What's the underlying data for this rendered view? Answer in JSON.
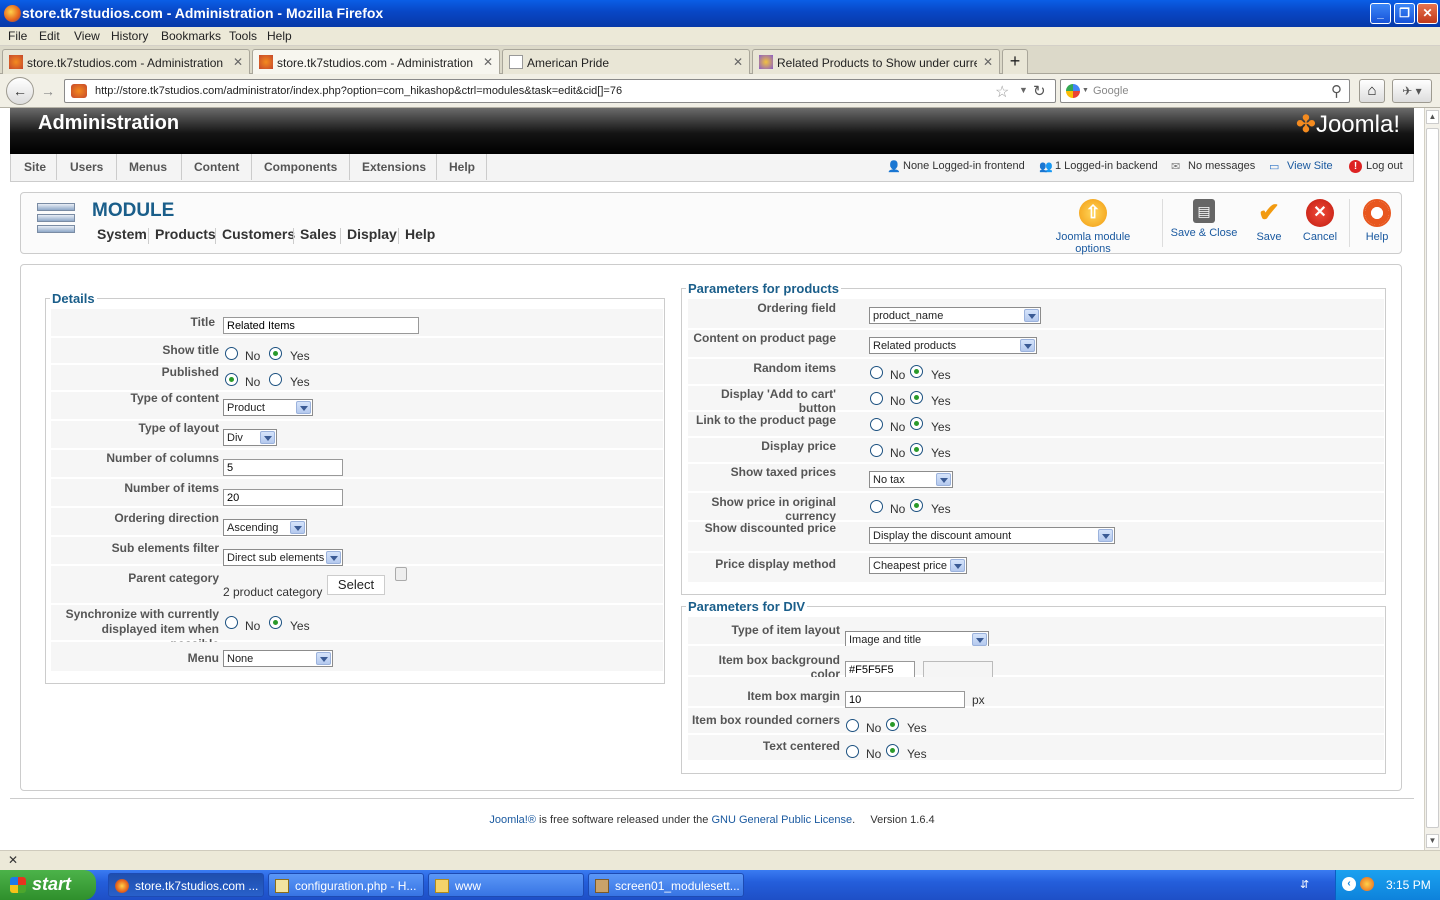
{
  "window": {
    "title": "store.tk7studios.com - Administration - Mozilla Firefox"
  },
  "menubar": [
    "File",
    "Edit",
    "View",
    "History",
    "Bookmarks",
    "Tools",
    "Help"
  ],
  "tabs": [
    {
      "label": "store.tk7studios.com - Administration",
      "active": false
    },
    {
      "label": "store.tk7studios.com - Administration",
      "active": true
    },
    {
      "label": "American Pride",
      "active": false
    },
    {
      "label": "Related Products to Show under current ...",
      "active": false
    }
  ],
  "nav": {
    "url": "http://store.tk7studios.com/administrator/index.php?option=com_hikashop&ctrl=modules&task=edit&cid[]=76",
    "search_placeholder": "Google"
  },
  "header": {
    "title": "Administration",
    "logo": "Joomla!"
  },
  "topmenu": [
    "Site",
    "Users",
    "Menus",
    "Content",
    "Components",
    "Extensions",
    "Help"
  ],
  "status": {
    "frontend": "None Logged-in frontend",
    "backend": "1 Logged-in backend",
    "messages": "No messages",
    "view_site": "View Site",
    "logout": "Log out"
  },
  "toolbar": {
    "title": "MODULE",
    "submenu": [
      "System",
      "Products",
      "Customers",
      "Sales",
      "Display",
      "Help"
    ],
    "buttons": {
      "options": "Joomla module options",
      "save_close": "Save & Close",
      "save": "Save",
      "cancel": "Cancel",
      "help": "Help"
    }
  },
  "details": {
    "legend": "Details",
    "title_label": "Title",
    "title_value": "Related Items",
    "show_title_label": "Show title",
    "published_label": "Published",
    "content_type_label": "Type of content",
    "content_type": "Product",
    "layout_type_label": "Type of layout",
    "layout_type": "Div",
    "columns_label": "Number of columns",
    "columns": "5",
    "items_label": "Number of items",
    "items": "20",
    "ordering_dir_label": "Ordering direction",
    "ordering_dir": "Ascending",
    "sub_filter_label": "Sub elements filter",
    "sub_filter": "Direct sub elements",
    "parent_cat_label": "Parent category",
    "parent_cat": "2 product category",
    "select_label": "Select",
    "sync_label1": "Synchronize with currently",
    "sync_label2": "displayed item when possible",
    "menu_label": "Menu",
    "menu": "None",
    "no": "No",
    "yes": "Yes"
  },
  "products": {
    "legend": "Parameters for products",
    "ordering_field_label": "Ordering field",
    "ordering_field": "product_name",
    "content_label": "Content on product page",
    "content": "Related products",
    "random_label": "Random items",
    "cart_label": "Display 'Add to cart' button",
    "link_label": "Link to the product page",
    "price_label": "Display price",
    "taxed_label": "Show taxed prices",
    "taxed": "No tax",
    "orig_currency_label": "Show price in original currency",
    "discount_label": "Show discounted price",
    "discount": "Display the discount amount",
    "price_method_label": "Price display method",
    "price_method": "Cheapest price"
  },
  "div": {
    "legend": "Parameters for DIV",
    "item_layout_label": "Type of item layout",
    "item_layout": "Image and title",
    "bg_color_label": "Item box background color",
    "bg_color": "#F5F5F5",
    "margin_label": "Item box margin",
    "margin": "10",
    "px": "px",
    "rounded_label": "Item box rounded corners",
    "centered_label": "Text centered"
  },
  "footer": {
    "joomla": "Joomla!®",
    "text1": " is free software released under the ",
    "license": "GNU General Public License",
    "text2": ".     Version 1.6.4"
  },
  "taskbar": {
    "start": "start",
    "tasks": [
      "store.tk7studios.com ...",
      "configuration.php - H...",
      "www",
      "screen01_modulesett..."
    ],
    "clock": "3:15 PM"
  }
}
